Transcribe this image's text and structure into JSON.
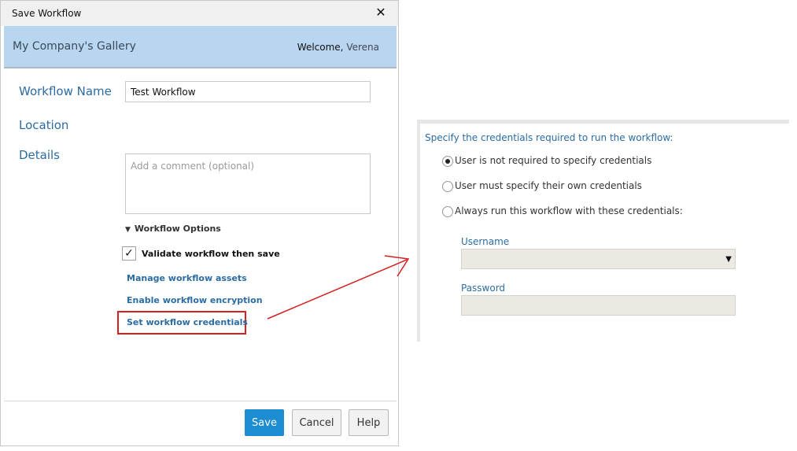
{
  "dialog": {
    "title": "Save Workflow",
    "close_glyph": "✕",
    "banner": {
      "gallery_name": "My Company's Gallery",
      "welcome_label": "Welcome,",
      "user_name": "Verena"
    },
    "fields": {
      "workflow_name_label": "Workflow Name",
      "workflow_name_value": "Test Workflow",
      "location_label": "Location",
      "details_label": "Details",
      "comment_placeholder": "Add a comment (optional)"
    },
    "options": {
      "header": "Workflow Options",
      "header_glyph": "▼",
      "validate_label": "Validate workflow then save",
      "validate_checked": true,
      "check_glyph": "✓",
      "links": {
        "manage_assets": "Manage workflow assets",
        "enable_encryption": "Enable workflow encryption",
        "set_credentials": "Set workflow credentials"
      }
    },
    "buttons": {
      "save": "Save",
      "cancel": "Cancel",
      "help": "Help"
    },
    "accent_color": "#1d8dd1",
    "highlight_color": "#d62020"
  },
  "credentials_panel": {
    "heading": "Specify the credentials required to run the workflow:",
    "options": [
      {
        "label": "User is not required to specify credentials",
        "selected": true
      },
      {
        "label": "User must specify their own credentials",
        "selected": false
      },
      {
        "label": "Always run this workflow with these credentials:",
        "selected": false
      }
    ],
    "username_label": "Username",
    "username_value": "",
    "password_label": "Password",
    "password_value": "",
    "caret_glyph": "▼"
  }
}
